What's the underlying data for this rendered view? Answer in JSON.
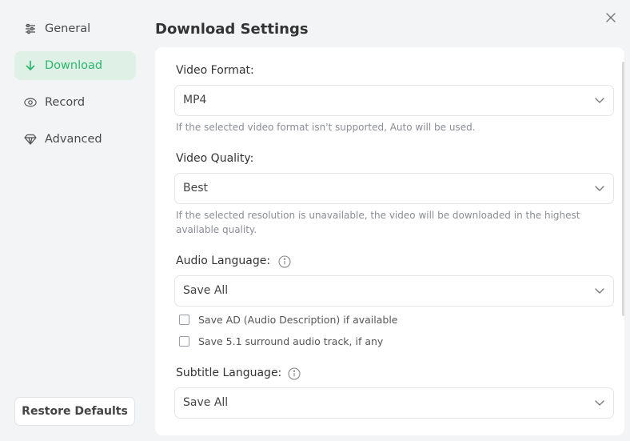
{
  "sidebar": {
    "items": [
      {
        "label": "General",
        "icon": "sliders-icon",
        "active": false
      },
      {
        "label": "Download",
        "icon": "arrow-down-icon",
        "active": true
      },
      {
        "label": "Record",
        "icon": "eye-icon",
        "active": false
      },
      {
        "label": "Advanced",
        "icon": "diamond-icon",
        "active": false
      }
    ],
    "restore_label": "Restore Defaults"
  },
  "header": {
    "title": "Download Settings"
  },
  "colors": {
    "accent": "#2bb86d",
    "active_bg": "#dff0e7"
  },
  "settings": {
    "video_format": {
      "label": "Video Format:",
      "value": "MP4",
      "hint": "If the selected video format isn't supported, Auto will be used."
    },
    "video_quality": {
      "label": "Video Quality:",
      "value": "Best",
      "hint": "If the selected resolution is unavailable, the video will be downloaded in the highest available quality."
    },
    "audio_language": {
      "label": "Audio Language:",
      "value": "Save All",
      "options": [
        {
          "label": "Save AD (Audio Description) if available",
          "checked": false
        },
        {
          "label": "Save 5.1 surround audio track, if any",
          "checked": false
        }
      ]
    },
    "subtitle_language": {
      "label": "Subtitle Language:",
      "value": "Save All"
    }
  }
}
